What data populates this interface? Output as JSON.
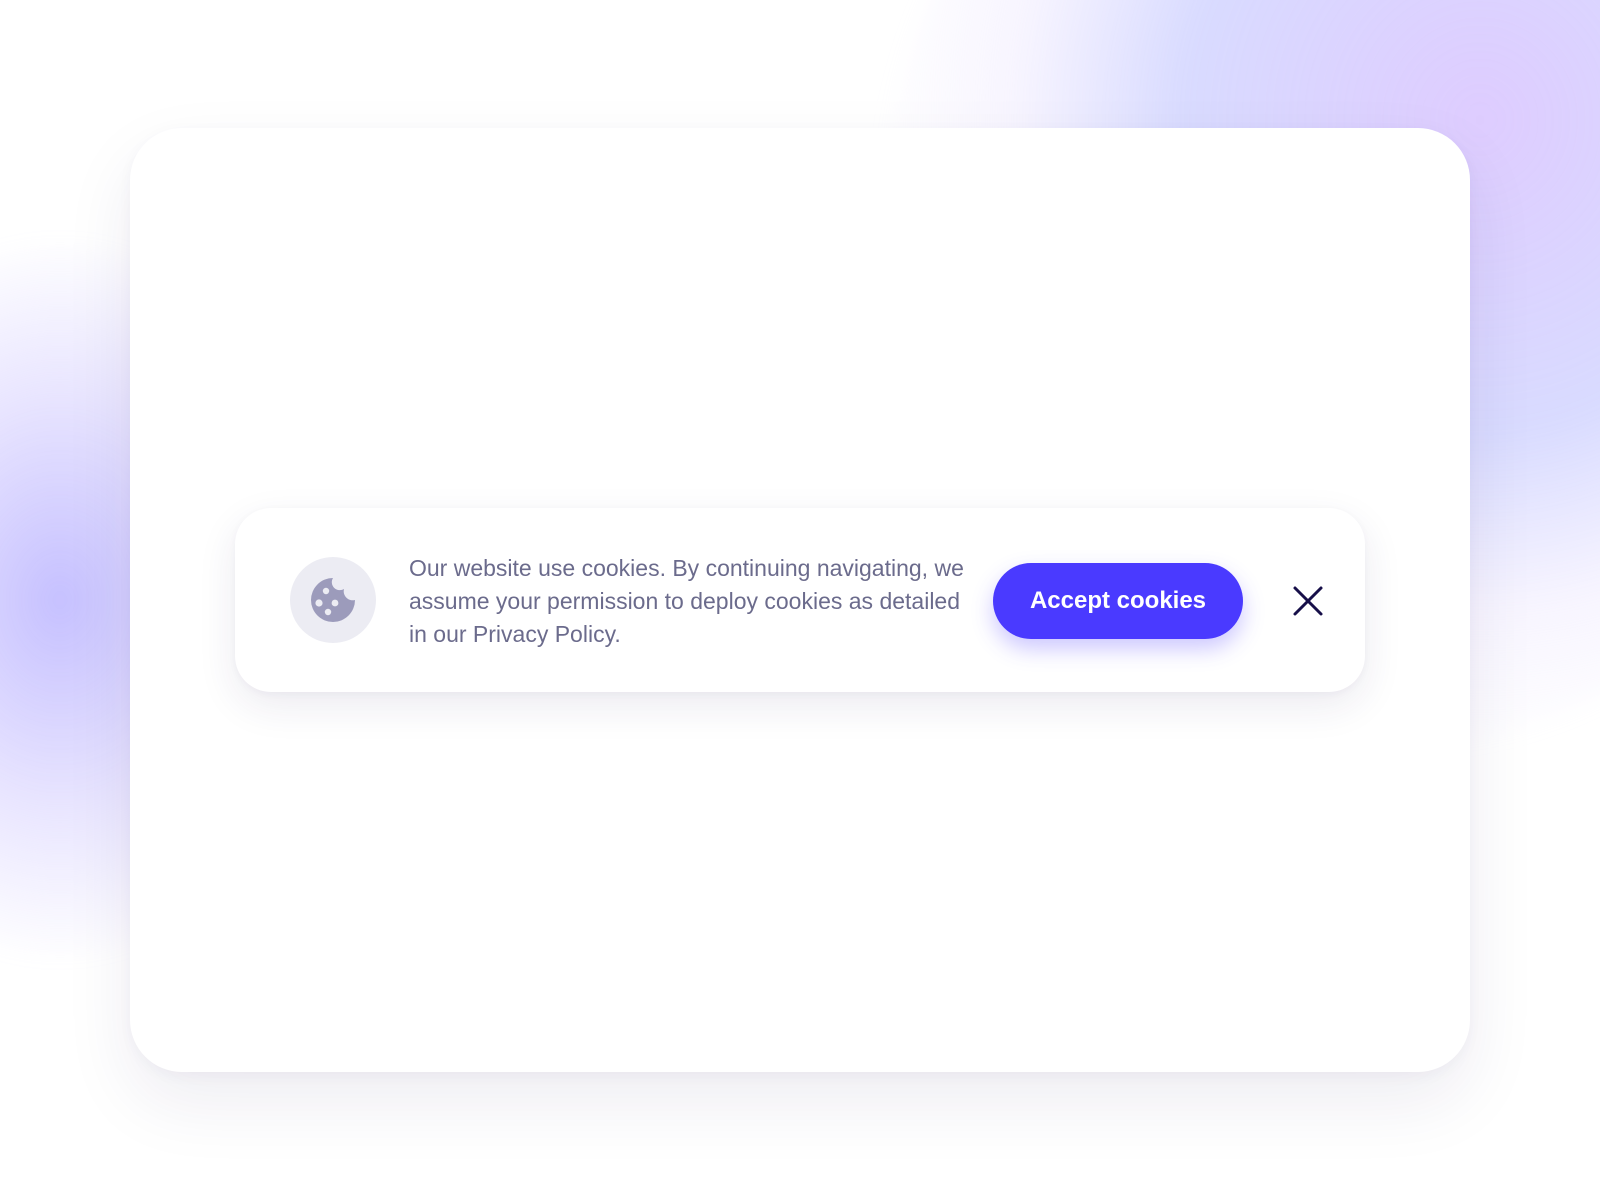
{
  "cookie_banner": {
    "message": "Our website use cookies. By continuing navigating, we assume your permission to deploy cookies as detailed in our Privacy Policy.",
    "accept_label": "Accept cookies",
    "icons": {
      "cookie": "cookie-icon",
      "close": "close-icon"
    }
  },
  "colors": {
    "accent": "#4a3aff",
    "text": "#6b6b8c",
    "icon": "#9c9bbb",
    "icon_bg": "#ececf3",
    "close": "#170f49"
  }
}
